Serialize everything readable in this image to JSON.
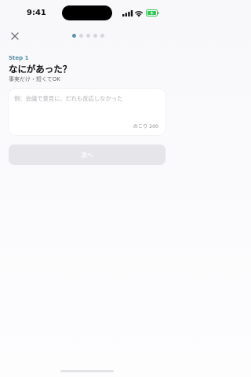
{
  "status_bar": {
    "time": "9:41",
    "battery_charging": true
  },
  "progress": {
    "total_steps": 5,
    "current_step": 1,
    "active_color": "#5b93a9"
  },
  "step": {
    "label": "Step 1",
    "title": "なにがあった？",
    "subtitle": "事実だけ・短くてOK"
  },
  "input": {
    "placeholder": "例：会議で意見に、だれも反応しなかった",
    "value": "",
    "counter": "のこり 200"
  },
  "actions": {
    "next_label": "次へ",
    "next_enabled": false
  },
  "colors": {
    "accent": "#4d8ea7",
    "battery_green": "#34c759"
  }
}
